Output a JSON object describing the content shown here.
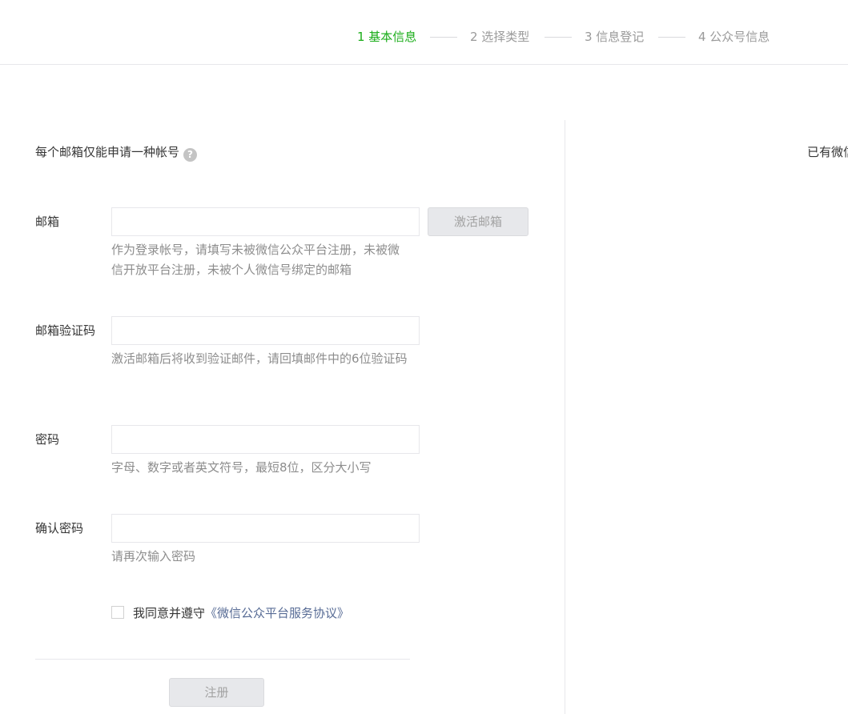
{
  "steps": [
    {
      "label": "1 基本信息",
      "active": true
    },
    {
      "label": "2 选择类型",
      "active": false
    },
    {
      "label": "3 信息登记",
      "active": false
    },
    {
      "label": "4 公众号信息",
      "active": false
    }
  ],
  "notice": {
    "text": "每个邮箱仅能申请一种帐号",
    "help_icon": "?"
  },
  "right_panel": {
    "text": "已有微信"
  },
  "form": {
    "email": {
      "label": "邮箱",
      "value": "",
      "placeholder": "",
      "tip": "作为登录帐号，请填写未被微信公众平台注册，未被微信开放平台注册，未被个人微信号绑定的邮箱",
      "activate_button": "激活邮箱"
    },
    "code": {
      "label": "邮箱验证码",
      "value": "",
      "placeholder": "",
      "tip": "激活邮箱后将收到验证邮件，请回填邮件中的6位验证码"
    },
    "password": {
      "label": "密码",
      "value": "",
      "placeholder": "",
      "tip": "字母、数字或者英文符号，最短8位，区分大小写"
    },
    "confirm_password": {
      "label": "确认密码",
      "value": "",
      "placeholder": "",
      "tip": "请再次输入密码"
    },
    "agreement": {
      "checked": false,
      "prefix": "我同意并遵守",
      "link": "《微信公众平台服务协议》"
    },
    "submit_label": "注册"
  },
  "colors": {
    "accent": "#1aad19",
    "link": "#576b95",
    "muted": "#8d8d8d",
    "disabled_bg": "#e7e8eb"
  }
}
